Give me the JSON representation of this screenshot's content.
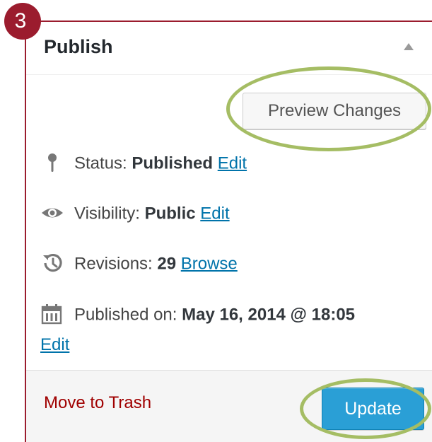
{
  "step": {
    "number": "3"
  },
  "publish_box": {
    "title": "Publish",
    "preview_button": "Preview Changes",
    "status": {
      "label": "Status: ",
      "value": "Published",
      "action": "Edit"
    },
    "visibility": {
      "label": "Visibility: ",
      "value": "Public",
      "action": "Edit"
    },
    "revisions": {
      "label": "Revisions: ",
      "value": "29",
      "action": "Browse"
    },
    "published_on": {
      "label": "Published on: ",
      "value": "May 16, 2014 @ 18:05",
      "action": "Edit"
    },
    "footer": {
      "trash_link": "Move to Trash",
      "update_button": "Update"
    }
  },
  "icons": {
    "status": "pin-icon",
    "visibility": "eye-icon",
    "revisions": "history-icon",
    "published_on": "calendar-icon",
    "toggle": "triangle-up-icon"
  },
  "colors": {
    "badge": "#9b1c2e",
    "highlight": "#a5bd64",
    "link": "#0073aa",
    "trash": "#a00000",
    "update_button": "#2a9fd6"
  }
}
